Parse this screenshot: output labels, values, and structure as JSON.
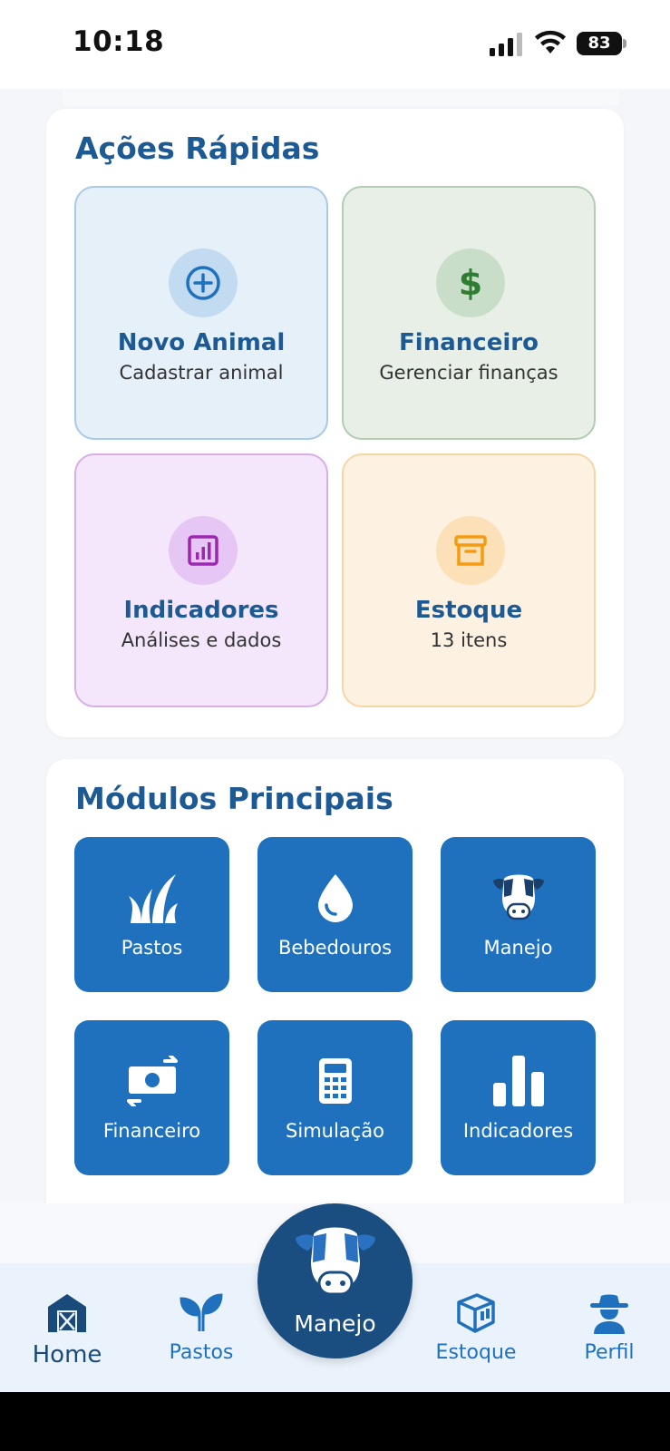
{
  "status_bar": {
    "time": "10:18",
    "battery": "83",
    "icons": [
      "signal-icon",
      "wifi-icon",
      "battery-icon"
    ]
  },
  "quick_actions": {
    "title": "Ações Rápidas",
    "items": [
      {
        "title": "Novo Animal",
        "subtitle": "Cadastrar animal",
        "icon": "plus-circle-icon",
        "bg": "#e6f0f9",
        "border": "#a9c9e6",
        "icon_bg": "#c3dbf0",
        "icon_color": "#1f71bd"
      },
      {
        "title": "Financeiro",
        "subtitle": "Gerenciar finanças",
        "icon": "dollar-icon",
        "bg": "#e7efe7",
        "border": "#b3cdb5",
        "icon_bg": "#c9dec9",
        "icon_color": "#2e7d32"
      },
      {
        "title": "Indicadores",
        "subtitle": "Análises e dados",
        "icon": "chart-icon",
        "bg": "#f4e6fb",
        "border": "#d7aee8",
        "icon_bg": "#e6c6f4",
        "icon_color": "#9c27b0"
      },
      {
        "title": "Estoque",
        "subtitle": "13 itens",
        "icon": "archive-icon",
        "bg": "#fdf1e2",
        "border": "#f6d6a4",
        "icon_bg": "#fce0b8",
        "icon_color": "#f39c12"
      }
    ]
  },
  "modules": {
    "title": "Módulos Principais",
    "items": [
      {
        "label": "Pastos",
        "icon": "grass-icon"
      },
      {
        "label": "Bebedouros",
        "icon": "water-drop-icon"
      },
      {
        "label": "Manejo",
        "icon": "cow-icon"
      },
      {
        "label": "Financeiro",
        "icon": "money-exchange-icon"
      },
      {
        "label": "Simulação",
        "icon": "calculator-icon"
      },
      {
        "label": "Indicadores",
        "icon": "bar-chart-icon"
      }
    ]
  },
  "bottom_nav": {
    "items": [
      {
        "label": "Home",
        "icon": "barn-icon",
        "active": true
      },
      {
        "label": "Pastos",
        "icon": "sprout-icon"
      },
      {
        "label": "Estoque",
        "icon": "box-icon"
      },
      {
        "label": "Perfil",
        "icon": "cowboy-icon"
      }
    ],
    "center": {
      "label": "Manejo",
      "icon": "cow-icon"
    }
  },
  "colors": {
    "primary": "#1f71bd",
    "title": "#1d5a93",
    "fab": "#1a4d80"
  }
}
